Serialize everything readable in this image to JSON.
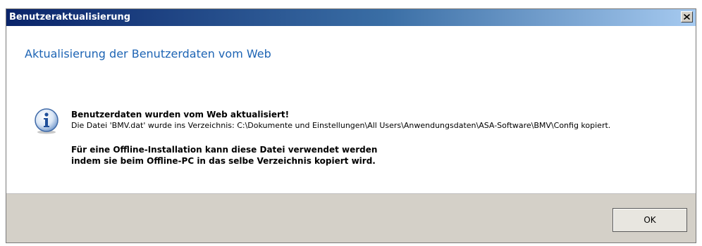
{
  "window": {
    "title": "Benutzeraktualisierung",
    "close_icon": "close-icon"
  },
  "header": {
    "instruction": "Aktualisierung der Benutzerdaten vom Web"
  },
  "message": {
    "icon": "info-icon",
    "headline": "Benutzerdaten wurden vom Web aktualisiert!",
    "detail": "Die Datei 'BMV.dat' wurde ins Verzeichnis:  C:\\Dokumente und Einstellungen\\All Users\\Anwendungsdaten\\ASA-Software\\BMV\\Config kopiert.",
    "note_line1": "Für eine Offline-Installation kann diese Datei verwendet werden",
    "note_line2": "indem sie beim Offline-PC in das selbe Verzeichnis kopiert wird."
  },
  "footer": {
    "ok_label": "OK"
  },
  "colors": {
    "instruction_text": "#1d64b4",
    "titlebar_start": "#0a246a",
    "titlebar_end": "#a6caf0",
    "footer_bg": "#d4d0c8"
  }
}
